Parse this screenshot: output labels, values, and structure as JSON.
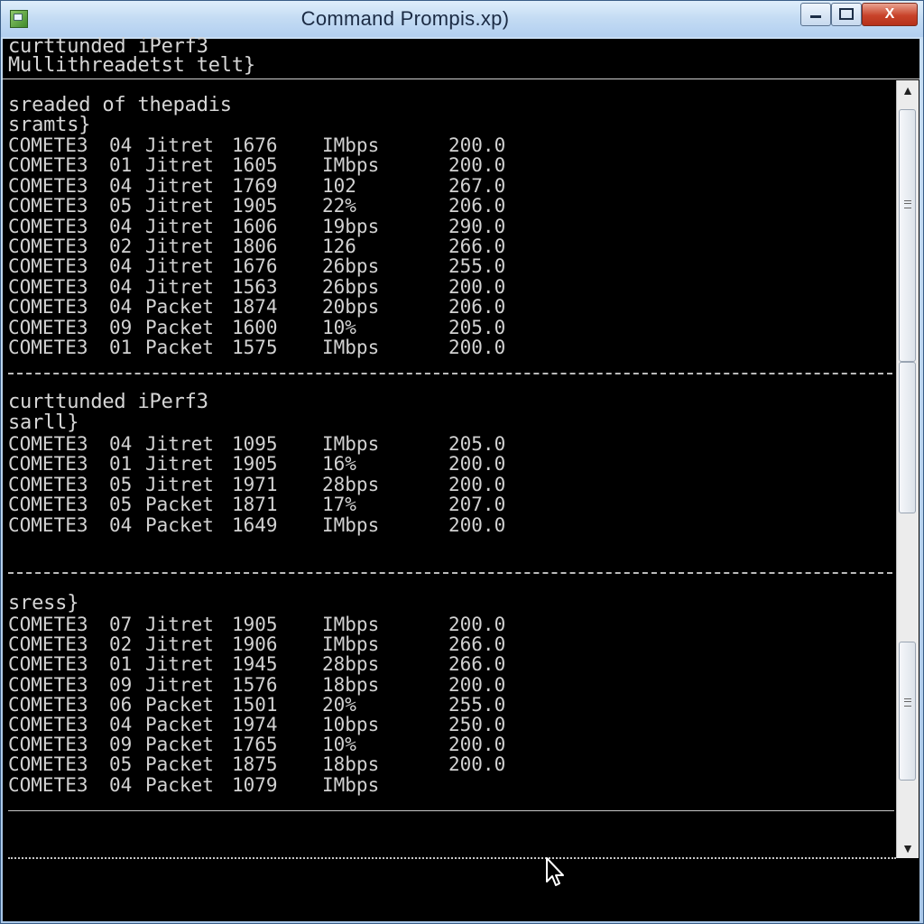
{
  "window": {
    "title": "Command Prompis.xp)",
    "minimize_label": "",
    "maximize_label": "",
    "close_label": "X"
  },
  "header": {
    "line1": "curttunded iPerf3",
    "line2": "Mullithreadetst telt}"
  },
  "section1": {
    "heading": "sreaded of thepadis",
    "label": "sramts}",
    "rows": [
      [
        "COMETE3",
        "04",
        "Jitret",
        "1676",
        "IMbps",
        "200.0"
      ],
      [
        "COMETE3",
        "01",
        "Jitret",
        "1605",
        "IMbps",
        "200.0"
      ],
      [
        "COMETE3",
        "04",
        "Jitret",
        "1769",
        "102",
        "267.0"
      ],
      [
        "COMETE3",
        "05",
        "Jitret",
        "1905",
        "22%",
        "206.0"
      ],
      [
        "COMETE3",
        "04",
        "Jitret",
        "1606",
        "19bps",
        "290.0"
      ],
      [
        "COMETE3",
        "02",
        "Jitret",
        "1806",
        "126",
        "266.0"
      ],
      [
        "COMETE3",
        "04",
        "Jitret",
        "1676",
        "26bps",
        "255.0"
      ],
      [
        "COMETE3",
        "04",
        "Jitret",
        "1563",
        "26bps",
        "200.0"
      ],
      [
        "COMETE3",
        "04",
        "Packet",
        "1874",
        "20bps",
        "206.0"
      ],
      [
        "COMETE3",
        "09",
        "Packet",
        "1600",
        "10%",
        "205.0"
      ],
      [
        "COMETE3",
        "01",
        "Packet",
        "1575",
        "IMbps",
        "200.0"
      ]
    ]
  },
  "section2": {
    "heading": "curttunded iPerf3",
    "label": "sarll}",
    "rows": [
      [
        "COMETE3",
        "04",
        "Jitret",
        "1095",
        "IMbps",
        "205.0"
      ],
      [
        "COMETE3",
        "01",
        "Jitret",
        "1905",
        "16%",
        "200.0"
      ],
      [
        "COMETE3",
        "05",
        "Jitret",
        "1971",
        "28bps",
        "200.0"
      ],
      [
        "COMETE3",
        "05",
        "Packet",
        "1871",
        "17%",
        "207.0"
      ],
      [
        "COMETE3",
        "04",
        "Packet",
        "1649",
        "IMbps",
        "200.0"
      ]
    ]
  },
  "section3": {
    "label": "sress}",
    "rows": [
      [
        "COMETE3",
        "07",
        "Jitret",
        "1905",
        "IMbps",
        "200.0"
      ],
      [
        "COMETE3",
        "02",
        "Jitret",
        "1906",
        "IMbps",
        "266.0"
      ],
      [
        "COMETE3",
        "01",
        "Jitret",
        "1945",
        "28bps",
        "266.0"
      ],
      [
        "COMETE3",
        "09",
        "Jitret",
        "1576",
        "18bps",
        "200.0"
      ],
      [
        "COMETE3",
        "06",
        "Packet",
        "1501",
        "20%",
        "255.0"
      ],
      [
        "COMETE3",
        "04",
        "Packet",
        "1974",
        "10bps",
        "250.0"
      ],
      [
        "COMETE3",
        "09",
        "Packet",
        "1765",
        "10%",
        "200.0"
      ],
      [
        "COMETE3",
        "05",
        "Packet",
        "1875",
        "18bps",
        "200.0"
      ],
      [
        "COMETE3",
        "04",
        "Packet",
        "1079",
        "IMbps",
        ""
      ]
    ]
  },
  "scrollbar": {
    "up_arrow": "▲",
    "down_arrow": "▼"
  },
  "icons": {
    "app": "command-prompt-icon",
    "cursor": "mouse-pointer-icon"
  }
}
